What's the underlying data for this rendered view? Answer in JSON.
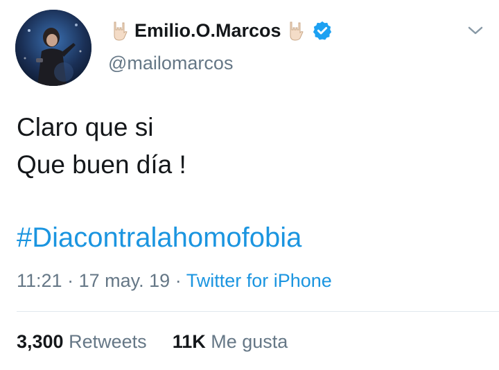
{
  "tweet": {
    "author": {
      "display_name": "Emilio.O.Marcos",
      "handle": "@mailomarcos",
      "verified": true,
      "name_emoji": "rock-hand-icon"
    },
    "text_lines": [
      "Claro que si",
      "Que buen día !"
    ],
    "hashtag": "#Diacontralahomofobia",
    "time": "11:21",
    "date": "17 may. 19",
    "separator": "·",
    "source": "Twitter for iPhone",
    "stats": {
      "retweets_count": "3,300",
      "retweets_label": "Retweets",
      "likes_count": "11K",
      "likes_label": "Me gusta"
    }
  },
  "colors": {
    "link": "#1b95e0",
    "secondary_text": "#657786",
    "primary_text": "#14171a",
    "divider": "#e1e8ed",
    "verified_badge": "#1da1f2"
  }
}
